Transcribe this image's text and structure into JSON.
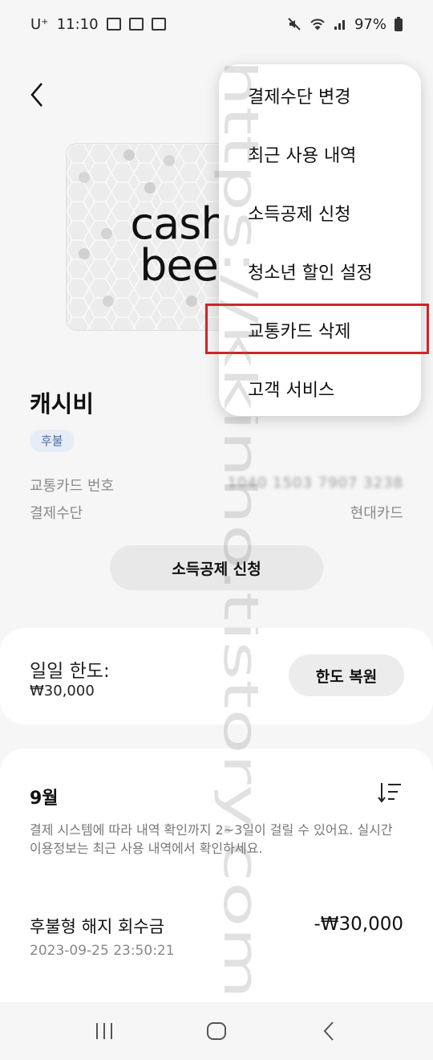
{
  "status_bar": {
    "carrier": "U⁺",
    "time": "11:10",
    "battery": "97%"
  },
  "card": {
    "logo_line1": "cash",
    "logo_line2": "bee",
    "name": "캐시비",
    "badge": "후불",
    "number_label": "교통카드 번호",
    "number_value": "1040 1503 7907 3238",
    "payment_label": "결제수단",
    "payment_value": "현대카드"
  },
  "deduction_button": "소득공제 신청",
  "limit": {
    "label": "일일 한도:",
    "value": "₩30,000",
    "restore_button": "한도 복원"
  },
  "history": {
    "month": "9월",
    "notice": "결제 시스템에 따라 내역 확인까지 2~3일이 걸릴 수 있어요. 실시간 이용정보는 최근 사용 내역에서 확인하세요.",
    "transactions": [
      {
        "title": "후불형 해지 회수금",
        "date": "2023-09-25 23:50:21",
        "amount": "-₩30,000"
      }
    ]
  },
  "menu": {
    "items": [
      {
        "label": "결제수단 변경"
      },
      {
        "label": "최근 사용 내역"
      },
      {
        "label": "소득공제 신청"
      },
      {
        "label": "청소년 할인 설정"
      },
      {
        "label": "교통카드 삭제"
      },
      {
        "label": "고객 서비스"
      }
    ],
    "highlighted_item": "교통카드 삭제",
    "highlight_color": "#d1232a"
  },
  "watermark": "https://kkinho.tistory.com",
  "colors": {
    "badge_text": "#4a6da8",
    "badge_bg": "#e7edf6"
  }
}
